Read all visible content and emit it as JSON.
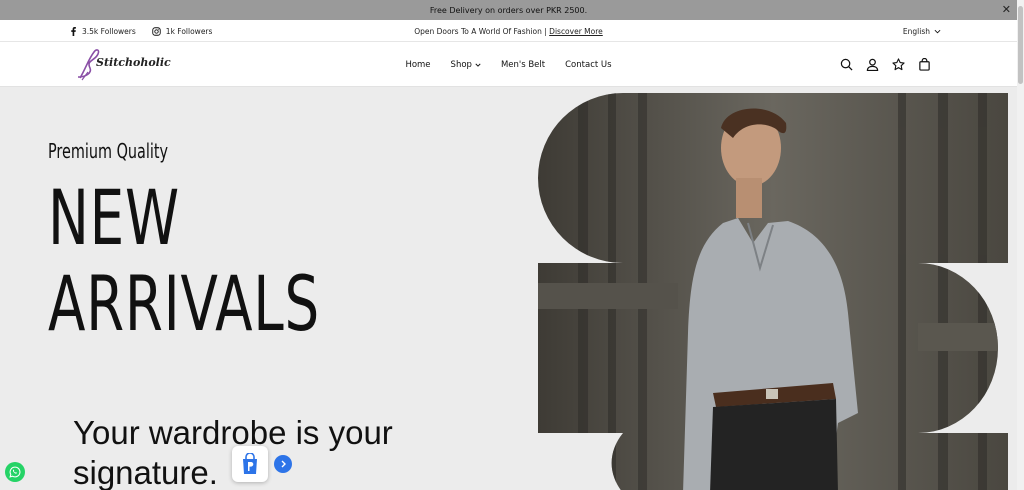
{
  "announcement": {
    "text": "Free Delivery on orders over PKR 2500.",
    "close": "✕"
  },
  "topbar": {
    "facebook": "3.5k Followers",
    "instagram": "1k Followers",
    "tagline": "Open Doors To A World Of Fashion | ",
    "tagline_link": "Discover More",
    "language": "English"
  },
  "header": {
    "logo_text": "Stitchoholic",
    "nav": [
      "Home",
      "Shop",
      "Men's Belt",
      "Contact Us"
    ]
  },
  "hero": {
    "kicker": "Premium Quality",
    "headline_1": "NEW",
    "headline_2": "ARRIVALS",
    "subtitle_1": "Your wardrobe is your",
    "subtitle_2": "signature."
  },
  "colors": {
    "announcement_bg": "#9a9a9a",
    "hero_bg": "#ececec",
    "accent_blue": "#2d74e8",
    "whatsapp": "#25d366",
    "logo_purple": "#8a4fa6"
  }
}
